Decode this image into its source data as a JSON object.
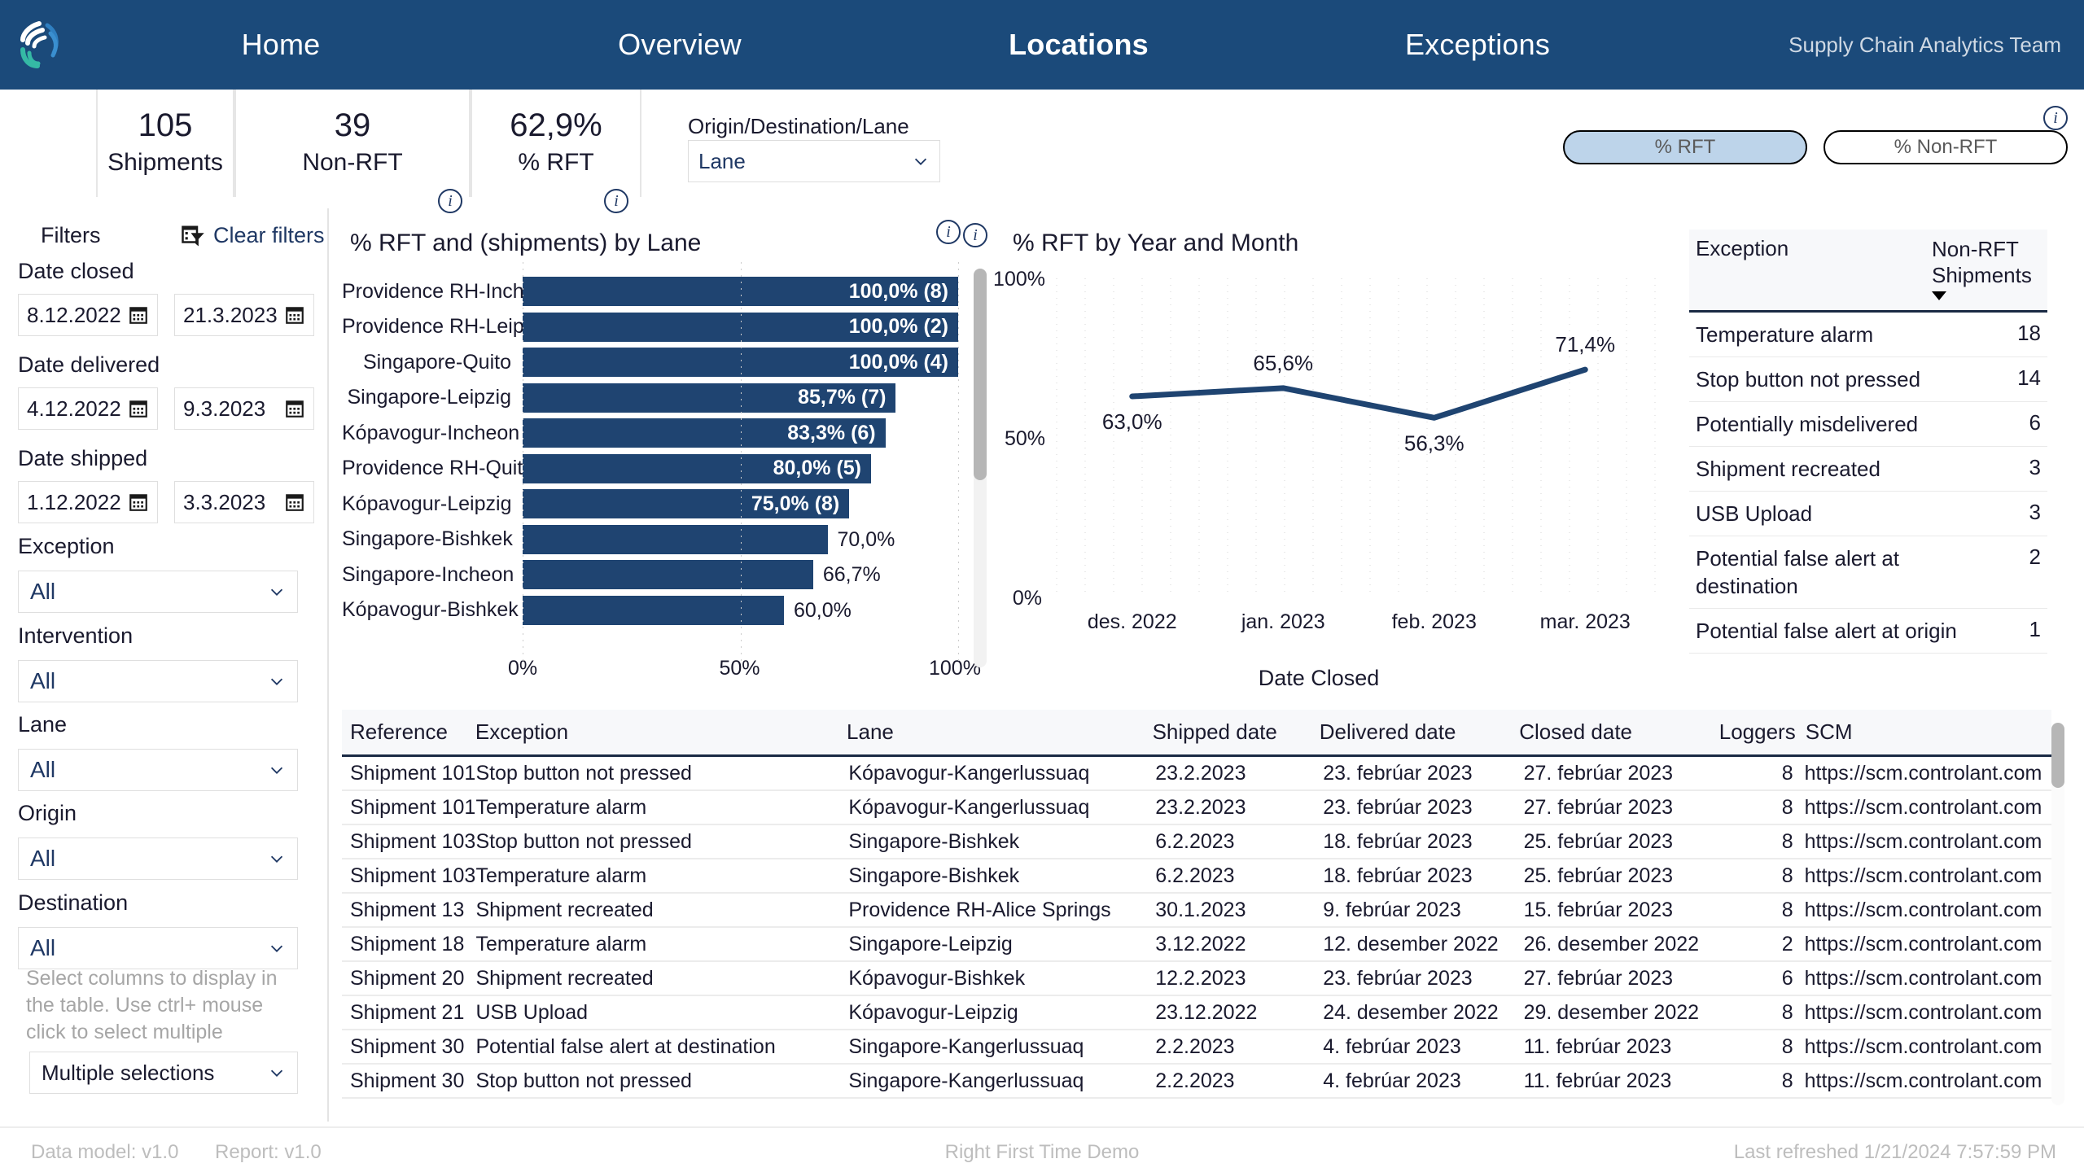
{
  "nav": {
    "logo_name": "controlant-logo",
    "links": [
      {
        "label": "Home",
        "active": false
      },
      {
        "label": "Overview",
        "active": false
      },
      {
        "label": "Locations",
        "active": true
      },
      {
        "label": "Exceptions",
        "active": false
      }
    ],
    "team": "Supply Chain Analytics Team",
    "bg_color": "#1b4a7a"
  },
  "kpis": [
    {
      "value": "105",
      "label": "Shipments",
      "has_info": false
    },
    {
      "value": "39",
      "label": "Non-RFT",
      "has_info": true
    },
    {
      "value": "62,9%",
      "label": "% RFT",
      "has_info": true
    }
  ],
  "odl": {
    "label": "Origin/Destination/Lane",
    "value": "Lane"
  },
  "toggles": {
    "rft": "% RFT",
    "non_rft": "% Non-RFT",
    "active": "% RFT",
    "active_color": "#bdd4ea"
  },
  "filters": {
    "title": "Filters",
    "clear": "Clear filters",
    "date_closed": {
      "label": "Date closed",
      "from": "8.12.2022",
      "to": "21.3.2023"
    },
    "date_delivered": {
      "label": "Date delivered",
      "from": "4.12.2022",
      "to": "9.3.2023"
    },
    "date_shipped": {
      "label": "Date shipped",
      "from": "1.12.2022",
      "to": "3.3.2023"
    },
    "dropdowns": [
      {
        "label": "Exception",
        "value": "All"
      },
      {
        "label": "Intervention",
        "value": "All"
      },
      {
        "label": "Lane",
        "value": "All"
      },
      {
        "label": "Origin",
        "value": "All"
      },
      {
        "label": "Destination",
        "value": "All"
      }
    ],
    "columns_help": "Select columns to display in the table. Use ctrl+ mouse click to select multiple",
    "columns_value": "Multiple selections"
  },
  "chart_data": [
    {
      "type": "bar",
      "orientation": "horizontal",
      "title": "% RFT and (shipments) by Lane",
      "xlabel": "",
      "ylabel": "",
      "xlim": [
        0,
        100
      ],
      "xticks": [
        "0%",
        "50%",
        "100%"
      ],
      "grid": true,
      "categories": [
        "Providence RH-Incheon",
        "Providence RH-Leipzig",
        "Singapore-Quito",
        "Singapore-Leipzig",
        "Kópavogur-Incheon",
        "Providence RH-Quito",
        "Kópavogur-Leipzig",
        "Singapore-Bishkek",
        "Singapore-Incheon",
        "Kópavogur-Bishkek"
      ],
      "values": [
        100.0,
        100.0,
        100.0,
        85.7,
        83.3,
        80.0,
        75.0,
        70.0,
        66.7,
        60.0
      ],
      "shipments": [
        8,
        2,
        4,
        7,
        6,
        5,
        8,
        null,
        null,
        null
      ],
      "data_labels": [
        "100,0%  (8)",
        "100,0%  (2)",
        "100,0%  (4)",
        "85,7%  (7)",
        "83,3%  (6)",
        "80,0%  (5)",
        "75,0%  (8)",
        "70,0%",
        "66,7%",
        "60,0%"
      ],
      "bar_color": "#1f4471"
    },
    {
      "type": "line",
      "title": "% RFT by Year and Month",
      "xlabel": "Date Closed",
      "ylabel": "",
      "ylim": [
        0,
        100
      ],
      "yticks": [
        "0%",
        "50%",
        "100%"
      ],
      "grid": true,
      "categories": [
        "des. 2022",
        "jan. 2023",
        "feb. 2023",
        "mar. 2023"
      ],
      "values": [
        63.0,
        65.6,
        56.3,
        71.4
      ],
      "data_labels": [
        "63,0%",
        "65,6%",
        "56,3%",
        "71,4%"
      ],
      "line_color": "#1f4471"
    }
  ],
  "exception_summary": {
    "headers": [
      "Exception",
      "Non-RFT Shipments"
    ],
    "sorted_by": "Non-RFT Shipments",
    "sort_dir": "desc",
    "rows": [
      {
        "exception": "Temperature alarm",
        "count": "18"
      },
      {
        "exception": "Stop button not pressed",
        "count": "14"
      },
      {
        "exception": "Potentially misdelivered",
        "count": "6"
      },
      {
        "exception": "Shipment recreated",
        "count": "3"
      },
      {
        "exception": "USB Upload",
        "count": "3"
      },
      {
        "exception": "Potential false alert at destination",
        "count": "2"
      },
      {
        "exception": "Potential false alert at origin",
        "count": "1"
      }
    ]
  },
  "detail_table": {
    "headers": [
      "Reference",
      "Exception",
      "Lane",
      "Shipped date",
      "Delivered date",
      "Closed date",
      "Loggers",
      "SCM"
    ],
    "rows": [
      [
        "Shipment 101",
        "Stop button not pressed",
        "Kópavogur-Kangerlussuaq",
        "23.2.2023",
        "23. febrúar 2023",
        "27. febrúar 2023",
        "8",
        "https://scm.controlant.com"
      ],
      [
        "Shipment 101",
        "Temperature alarm",
        "Kópavogur-Kangerlussuaq",
        "23.2.2023",
        "23. febrúar 2023",
        "27. febrúar 2023",
        "8",
        "https://scm.controlant.com"
      ],
      [
        "Shipment 103",
        "Stop button not pressed",
        "Singapore-Bishkek",
        "6.2.2023",
        "18. febrúar 2023",
        "25. febrúar 2023",
        "8",
        "https://scm.controlant.com"
      ],
      [
        "Shipment 103",
        "Temperature alarm",
        "Singapore-Bishkek",
        "6.2.2023",
        "18. febrúar 2023",
        "25. febrúar 2023",
        "8",
        "https://scm.controlant.com"
      ],
      [
        "Shipment 13",
        "Shipment recreated",
        "Providence RH-Alice Springs",
        "30.1.2023",
        "9. febrúar 2023",
        "15. febrúar 2023",
        "8",
        "https://scm.controlant.com"
      ],
      [
        "Shipment 18",
        "Temperature alarm",
        "Singapore-Leipzig",
        "3.12.2022",
        "12. desember 2022",
        "26. desember 2022",
        "2",
        "https://scm.controlant.com"
      ],
      [
        "Shipment 20",
        "Shipment recreated",
        "Kópavogur-Bishkek",
        "12.2.2023",
        "23. febrúar 2023",
        "27. febrúar 2023",
        "6",
        "https://scm.controlant.com"
      ],
      [
        "Shipment 21",
        "USB Upload",
        "Kópavogur-Leipzig",
        "23.12.2022",
        "24. desember 2022",
        "29. desember 2022",
        "8",
        "https://scm.controlant.com"
      ],
      [
        "Shipment 30",
        "Potential false alert at destination",
        "Singapore-Kangerlussuaq",
        "2.2.2023",
        "4. febrúar 2023",
        "11. febrúar 2023",
        "8",
        "https://scm.controlant.com"
      ],
      [
        "Shipment 30",
        "Stop button not pressed",
        "Singapore-Kangerlussuaq",
        "2.2.2023",
        "4. febrúar 2023",
        "11. febrúar 2023",
        "8",
        "https://scm.controlant.com"
      ]
    ]
  },
  "footer": {
    "data_model": "Data model: v1.0",
    "report": "Report: v1.0",
    "center": "Right First Time Demo",
    "refreshed": "Last refreshed 1/21/2024 7:57:59 PM"
  }
}
